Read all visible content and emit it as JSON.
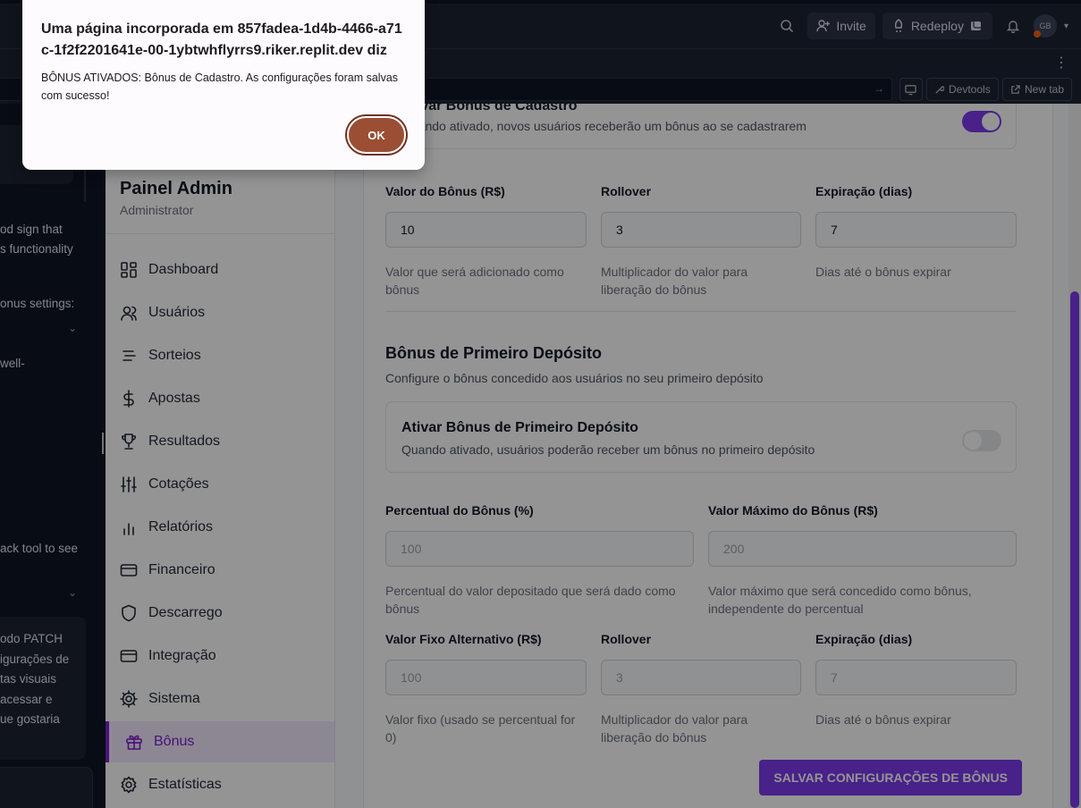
{
  "replit": {
    "invite_label": "Invite",
    "redeploy_label": "Redeploy",
    "avatar_initials": "GB",
    "devtools_label": "Devtools",
    "new_tab_label": "New tab"
  },
  "agent_panel": {
    "lines": [
      "od sign that",
      "s functionality",
      "onus settings:",
      "well-",
      "ack tool to see",
      "odo PATCH",
      "igurações de",
      "tas visuais",
      "acessar e",
      "ue gostaria"
    ]
  },
  "sidebar": {
    "brand_title": "Painel Admin",
    "brand_subtitle": "Administrator",
    "items": [
      {
        "label": "Dashboard",
        "icon": "dashboard-icon"
      },
      {
        "label": "Usuários",
        "icon": "users-icon"
      },
      {
        "label": "Sorteios",
        "icon": "list-icon"
      },
      {
        "label": "Apostas",
        "icon": "dollar-icon"
      },
      {
        "label": "Resultados",
        "icon": "trophy-icon"
      },
      {
        "label": "Cotações",
        "icon": "sliders-icon"
      },
      {
        "label": "Relatórios",
        "icon": "bar-chart-icon"
      },
      {
        "label": "Financeiro",
        "icon": "credit-card-icon"
      },
      {
        "label": "Descarrego",
        "icon": "shield-icon"
      },
      {
        "label": "Integração",
        "icon": "credit-card-icon"
      },
      {
        "label": "Sistema",
        "icon": "cog-icon"
      },
      {
        "label": "Bônus",
        "icon": "gift-icon",
        "active": true
      },
      {
        "label": "Estatísticas",
        "icon": "gear-icon"
      }
    ]
  },
  "signup_bonus": {
    "toggle_title": "Ativar Bônus de Cadastro",
    "toggle_desc": "Quando ativado, novos usuários receberão um bônus ao se cadastrarem",
    "enabled": true,
    "fields": [
      {
        "label": "Valor do Bônus (R$)",
        "value": "10",
        "help": "Valor que será adicionado como bônus"
      },
      {
        "label": "Rollover",
        "value": "3",
        "help": "Multiplicador do valor para liberação do bônus"
      },
      {
        "label": "Expiração (dias)",
        "value": "7",
        "help": "Dias até o bônus expirar"
      }
    ]
  },
  "first_deposit_bonus": {
    "title": "Bônus de Primeiro Depósito",
    "description": "Configure o bônus concedido aos usuários no seu primeiro depósito",
    "toggle_title": "Ativar Bônus de Primeiro Depósito",
    "toggle_desc": "Quando ativado, usuários poderão receber um bônus no primeiro depósito",
    "enabled": false,
    "row1": [
      {
        "label": "Percentual do Bônus (%)",
        "placeholder": "100",
        "help": "Percentual do valor depositado que será dado como bônus"
      },
      {
        "label": "Valor Máximo do Bônus (R$)",
        "placeholder": "200",
        "help": "Valor máximo que será concedido como bônus, independente do percentual"
      }
    ],
    "row2": [
      {
        "label": "Valor Fixo Alternativo (R$)",
        "placeholder": "100",
        "help": "Valor fixo (usado se percentual for 0)"
      },
      {
        "label": "Rollover",
        "placeholder": "3",
        "help": "Multiplicador do valor para liberação do bônus"
      },
      {
        "label": "Expiração (dias)",
        "placeholder": "7",
        "help": "Dias até o bônus expirar"
      }
    ]
  },
  "save_button_label": "SALVAR CONFIGURAÇÕES DE BÔNUS",
  "dialog": {
    "title": "Uma página incorporada em 857fadea-1d4b-4466-a71c-1f2f2201641e-00-1ybtwhflyrrs9.riker.replit.dev diz",
    "message": "BÔNUS ATIVADOS: Bônus de Cadastro. As configurações foram salvas com sucesso!",
    "ok_label": "OK"
  }
}
